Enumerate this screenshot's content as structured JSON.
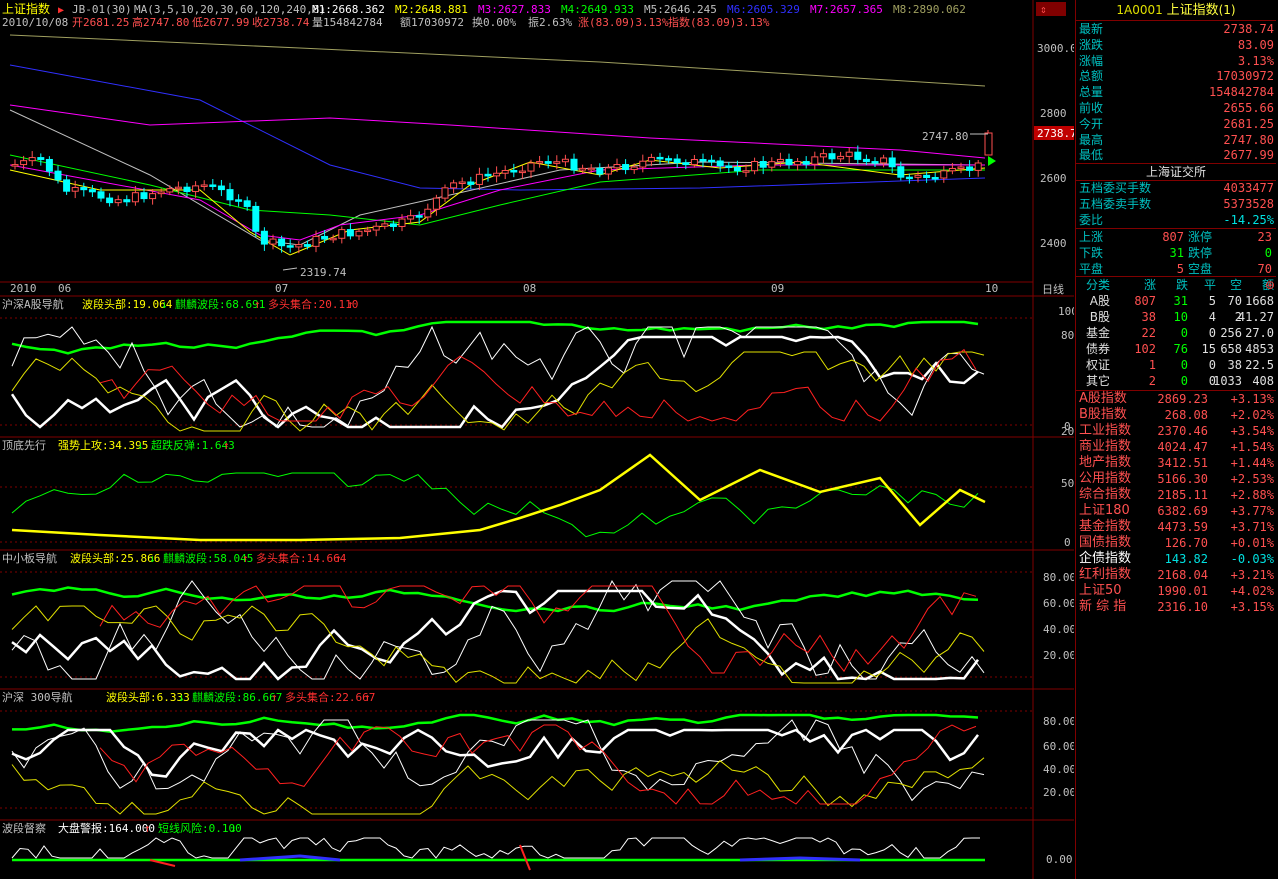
{
  "header": {
    "index_name": "上证指数",
    "formula": "JB-01(30)",
    "ma_params": "MA(3,5,10,20,30,60,120,240,8)",
    "ma": [
      {
        "label": "M1:2668.362",
        "color": "#ffffff"
      },
      {
        "label": "M2:2648.881",
        "color": "#ffff00"
      },
      {
        "label": "M3:2627.833",
        "color": "#ff00ff"
      },
      {
        "label": "M4:2649.933",
        "color": "#00ff00"
      },
      {
        "label": "M5:2646.245",
        "color": "#c0c0c0"
      },
      {
        "label": "M6:2605.329",
        "color": "#3030ff"
      },
      {
        "label": "M7:2657.365",
        "color": "#ff00ff"
      },
      {
        "label": "M8:2890.062",
        "color": "#a0a060"
      }
    ],
    "date": "2010/10/08",
    "open": "开2681.25",
    "high": "高2747.80",
    "low": "低2677.99",
    "close": "收2738.74",
    "volume": "量154842784",
    "amount": "额17030972",
    "turnover": "换0.00%",
    "amplitude": "振2.63%",
    "change": "涨(83.09)3.13%",
    "index_change": "指数(83.09)3.13%"
  },
  "price_axis": {
    "labels": [
      "3000.0",
      "2800",
      "2600",
      "2400"
    ],
    "current": "2738.7",
    "marker_high": "2747.80",
    "marker_low": "2319.74"
  },
  "date_axis": {
    "labels": [
      "2010",
      "06",
      "07",
      "08",
      "09",
      "10"
    ],
    "period": "日线"
  },
  "indicators": [
    {
      "title": "沪深A股导航",
      "items": [
        {
          "label": "波段头部:19.064",
          "color": "#ffff00",
          "arrow": "↓"
        },
        {
          "label": "麒麟波段:68.691",
          "color": "#00ff00",
          "arrow": "↑"
        },
        {
          "label": "多头集合:20.110",
          "color": "#ff3030",
          "arrow": "↑"
        }
      ],
      "axis": [
        "100",
        "80",
        "20",
        "0"
      ]
    },
    {
      "title": "顶底先行",
      "items": [
        {
          "label": "强势上攻:34.395",
          "color": "#ffff00",
          "arrow": "↓"
        },
        {
          "label": "超跌反弹:1.643",
          "color": "#00ff00",
          "arrow": "↑"
        }
      ],
      "axis": [
        "50",
        "0"
      ]
    },
    {
      "title": "中小板导航",
      "items": [
        {
          "label": "波段头部:25.866",
          "color": "#ffff00",
          "arrow": "↓"
        },
        {
          "label": "麒麟波段:58.045",
          "color": "#00ff00",
          "arrow": "↑"
        },
        {
          "label": "多头集合:14.664",
          "color": "#ff3030",
          "arrow": "↑"
        }
      ],
      "axis": [
        "80.00",
        "60.00",
        "40.00",
        "20.00"
      ]
    },
    {
      "title": "沪深 300导航",
      "items": [
        {
          "label": "波段头部:6.333",
          "color": "#ffff00",
          "arrow": "↓"
        },
        {
          "label": "麒麟波段:86.667",
          "color": "#00ff00",
          "arrow": "↑"
        },
        {
          "label": "多头集合:22.667",
          "color": "#ff3030",
          "arrow": "↑"
        }
      ],
      "axis": [
        "80.00",
        "60.00",
        "40.00",
        "20.00"
      ]
    },
    {
      "title": "波段督察",
      "items": [
        {
          "label": "大盘警报:164.000",
          "color": "#ffffff",
          "arrow": "↑"
        },
        {
          "label": "短线风险:0.100",
          "color": "#00ff00",
          "arrow": "↓"
        }
      ],
      "axis": [
        "0.00"
      ]
    }
  ],
  "quote": {
    "code": "1A0001",
    "name": "上证指数",
    "suffix": "(1)",
    "rows": [
      {
        "label": "最新",
        "value": "2738.74"
      },
      {
        "label": "涨跌",
        "value": "83.09"
      },
      {
        "label": "涨幅",
        "value": "3.13%"
      },
      {
        "label": "总额",
        "value": "17030972"
      },
      {
        "label": "总量",
        "value": "154842784"
      },
      {
        "label": "前收",
        "value": "2655.66"
      },
      {
        "label": "今开",
        "value": "2681.25"
      },
      {
        "label": "最高",
        "value": "2747.80"
      },
      {
        "label": "最低",
        "value": "2677.99"
      }
    ]
  },
  "exchange": {
    "title": "上海证交所",
    "rows": [
      {
        "label": "五档委买手数",
        "value": "4033477"
      },
      {
        "label": "五档委卖手数",
        "value": "5373528"
      },
      {
        "label": "委比",
        "value": "-14.25%"
      }
    ],
    "breadth": [
      {
        "l1": "上涨",
        "v1": "807",
        "l2": "涨停",
        "v2": "23"
      },
      {
        "l1": "下跌",
        "v1": "31",
        "l2": "跌停",
        "v2": "0"
      },
      {
        "l1": "平盘",
        "v1": "5",
        "l2": "空盘",
        "v2": "70"
      }
    ]
  },
  "category_table": {
    "headers": [
      "分类",
      "涨",
      "跌",
      "平",
      "空",
      "额"
    ],
    "rows": [
      {
        "name": "A股",
        "up": "807",
        "down": "31",
        "flat": "5",
        "empty": "70",
        "amount": "1668"
      },
      {
        "name": "B股",
        "up": "38",
        "down": "10",
        "flat": "4",
        "empty": "2",
        "amount": "41.27"
      },
      {
        "name": "基金",
        "up": "22",
        "down": "0",
        "flat": "0",
        "empty": "256",
        "amount": "27.0"
      },
      {
        "name": "债券",
        "up": "102",
        "down": "76",
        "flat": "15",
        "empty": "658",
        "amount": "4853"
      },
      {
        "name": "权证",
        "up": "1",
        "down": "0",
        "flat": "0",
        "empty": "38",
        "amount": "22.5"
      },
      {
        "name": "其它",
        "up": "2",
        "down": "0",
        "flat": "0",
        "empty": "1033",
        "amount": "408"
      }
    ]
  },
  "index_list": [
    {
      "name": "A股指数",
      "value": "2869.23",
      "change": "+3.13%",
      "color": "#ff5050"
    },
    {
      "name": "B股指数",
      "value": "268.08",
      "change": "+2.02%",
      "color": "#ff5050"
    },
    {
      "name": "工业指数",
      "value": "2370.46",
      "change": "+3.54%",
      "color": "#ff5050"
    },
    {
      "name": "商业指数",
      "value": "4024.47",
      "change": "+1.54%",
      "color": "#ff5050"
    },
    {
      "name": "地产指数",
      "value": "3412.51",
      "change": "+1.44%",
      "color": "#ff5050"
    },
    {
      "name": "公用指数",
      "value": "5166.30",
      "change": "+2.53%",
      "color": "#ff5050"
    },
    {
      "name": "综合指数",
      "value": "2185.11",
      "change": "+2.88%",
      "color": "#ff5050"
    },
    {
      "name": "上证180",
      "value": "6382.69",
      "change": "+3.77%",
      "color": "#ff5050"
    },
    {
      "name": "基金指数",
      "value": "4473.59",
      "change": "+3.71%",
      "color": "#ff5050"
    },
    {
      "name": "国债指数",
      "value": "126.70",
      "change": "+0.01%",
      "color": "#ff5050"
    },
    {
      "name": "企债指数",
      "value": "143.82",
      "change": "-0.03%",
      "color": "#00e0e0"
    },
    {
      "name": "红利指数",
      "value": "2168.04",
      "change": "+3.21%",
      "color": "#ff5050"
    },
    {
      "name": "上证50",
      "value": "1990.01",
      "change": "+4.02%",
      "color": "#ff5050"
    },
    {
      "name": "新 综 指",
      "value": "2316.10",
      "change": "+3.15%",
      "color": "#ff5050"
    }
  ],
  "colors": {
    "up": "#ff5050",
    "down": "#00ffff",
    "grid": "#800000",
    "label": "#00c0c0",
    "accent": "#ffff00"
  }
}
